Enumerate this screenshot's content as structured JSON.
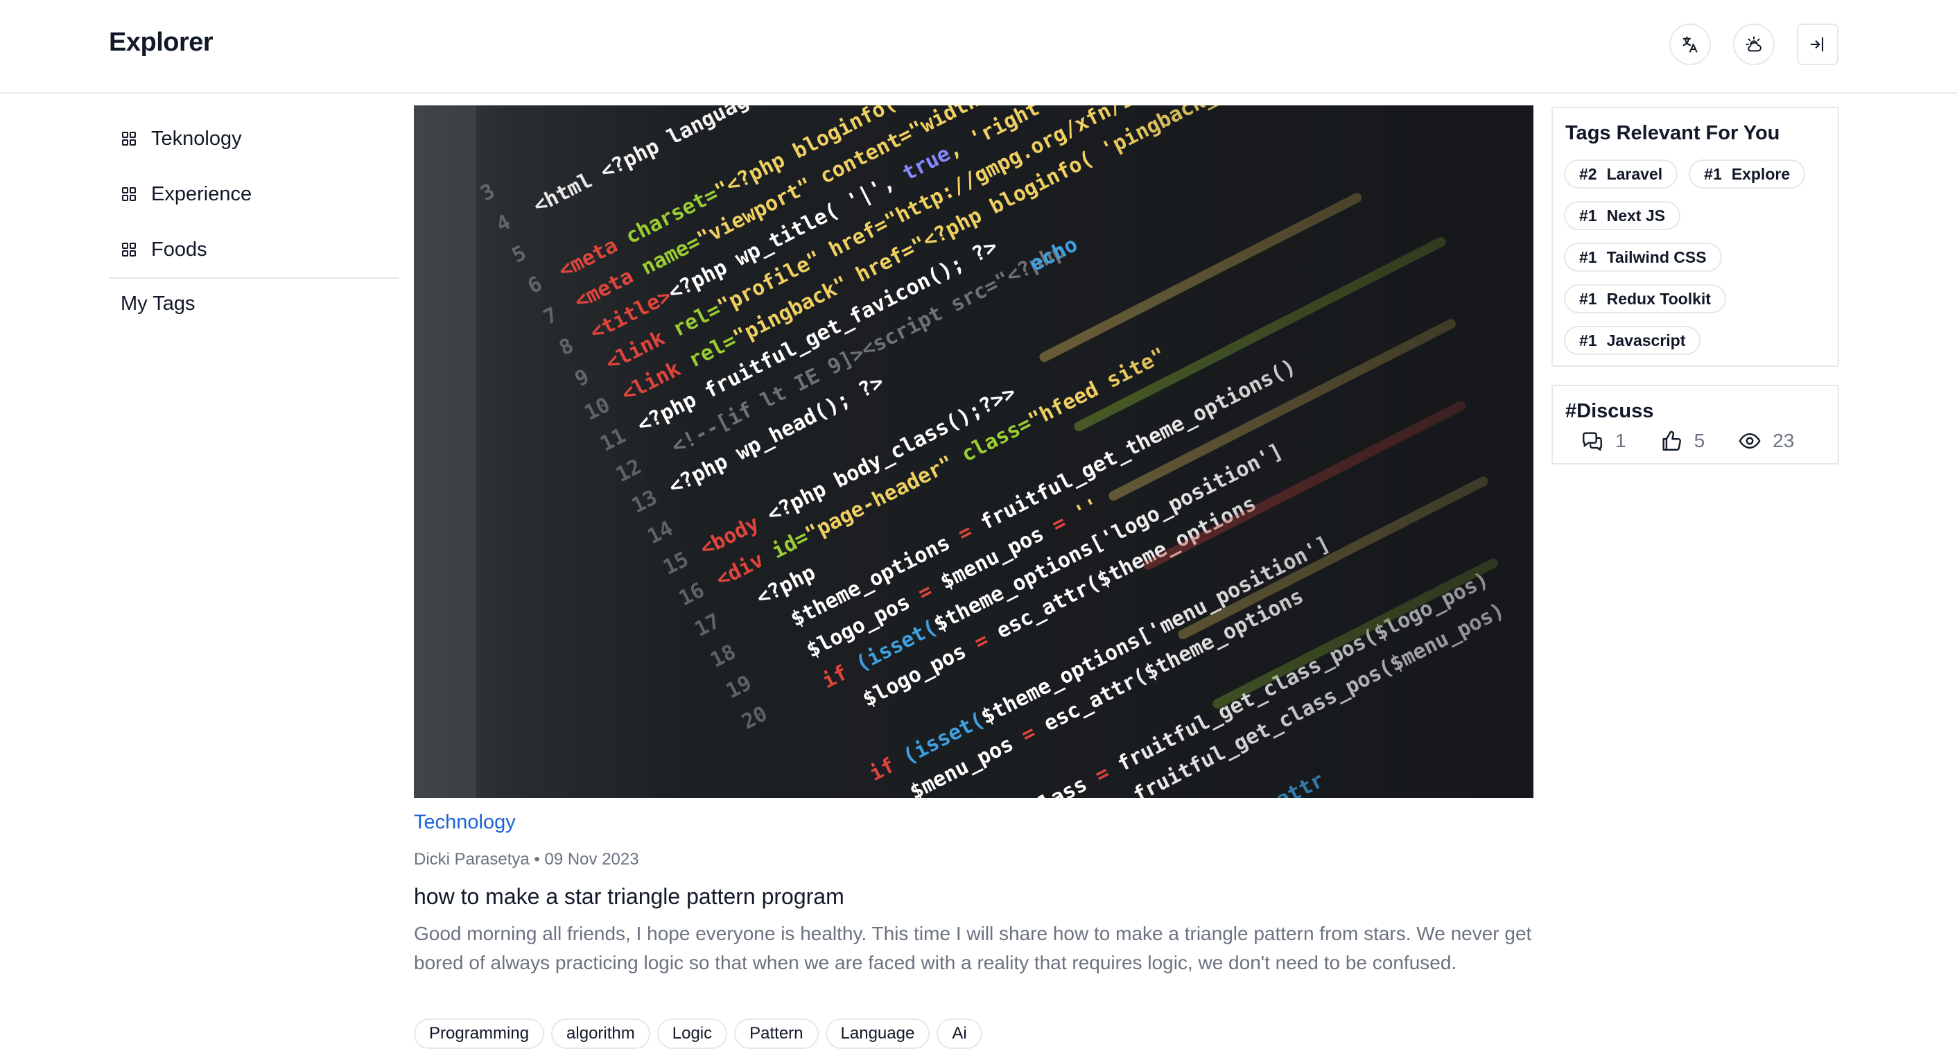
{
  "header": {
    "brand": "Explorer",
    "icons": [
      "translate-icon",
      "weather-icon",
      "login-icon"
    ]
  },
  "sidebar": {
    "items": [
      {
        "label": "Teknology",
        "icon": "grid-icon"
      },
      {
        "label": "Experience",
        "icon": "grid-icon"
      },
      {
        "label": "Foods",
        "icon": "grid-icon"
      }
    ],
    "heading": "My Tags"
  },
  "post": {
    "category": "Technology",
    "author": "Dicki Parasetya",
    "separator": "•",
    "date": "09 Nov 2023",
    "title": "how to make a star triangle pattern program",
    "excerpt": "Good morning all friends, I hope everyone is healthy. This time I will share how to make a triangle pattern from stars. We never get bored of always practicing logic so that when we are faced with a reality that requires logic, we don't need to be confused.",
    "tags": [
      "Programming",
      "algorithm",
      "Logic",
      "Pattern",
      "Language",
      "Ai"
    ]
  },
  "relevant_tags": {
    "title": "Tags Relevant For You",
    "items": [
      {
        "rank": "#2",
        "name": "Laravel"
      },
      {
        "rank": "#1",
        "name": "Explore"
      },
      {
        "rank": "#1",
        "name": "Next JS"
      },
      {
        "rank": "#1",
        "name": "Tailwind CSS"
      },
      {
        "rank": "#1",
        "name": "Redux Toolkit"
      },
      {
        "rank": "#1",
        "name": "Javascript"
      }
    ]
  },
  "discuss": {
    "title": "#Discuss",
    "comments": "1",
    "likes": "5",
    "views": "23"
  },
  "colors": {
    "accent": "#1d63d6",
    "muted_text": "#6b7280",
    "border": "#e5e7eb"
  }
}
